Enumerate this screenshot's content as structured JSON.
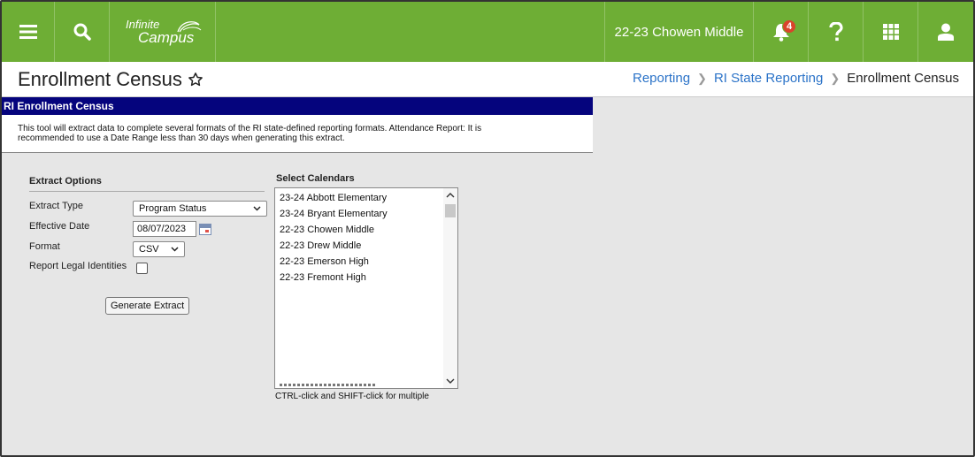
{
  "topbar": {
    "logo_line1": "Infinite",
    "logo_line2": "Campus",
    "school_name": "22-23 Chowen Middle",
    "notification_count": "4",
    "brand_color": "#6eae35"
  },
  "header": {
    "title": "Enrollment Census",
    "breadcrumb": [
      "Reporting",
      "RI State Reporting",
      "Enrollment Census"
    ]
  },
  "panel": {
    "heading": "RI Enrollment Census",
    "description_line1": "This tool will extract data to complete several formats of the RI state-defined reporting formats. Attendance Report: It is",
    "description_line2": "recommended to use a Date Range less than 30 days when generating this extract."
  },
  "extract_options": {
    "section_title": "Extract Options",
    "extract_type_label": "Extract Type",
    "extract_type_value": "Program Status",
    "effective_date_label": "Effective Date",
    "effective_date_value": "08/07/2023",
    "format_label": "Format",
    "format_value": "CSV",
    "legal_identities_label": "Report Legal Identities",
    "legal_identities_checked": false,
    "generate_button": "Generate Extract"
  },
  "calendars": {
    "section_title": "Select Calendars",
    "items": [
      "23-24 Abbott Elementary",
      "23-24 Bryant Elementary",
      "22-23 Chowen Middle",
      "22-23 Drew Middle",
      "22-23 Emerson High",
      "22-23 Fremont High"
    ],
    "hint": "CTRL-click and SHIFT-click for multiple"
  }
}
